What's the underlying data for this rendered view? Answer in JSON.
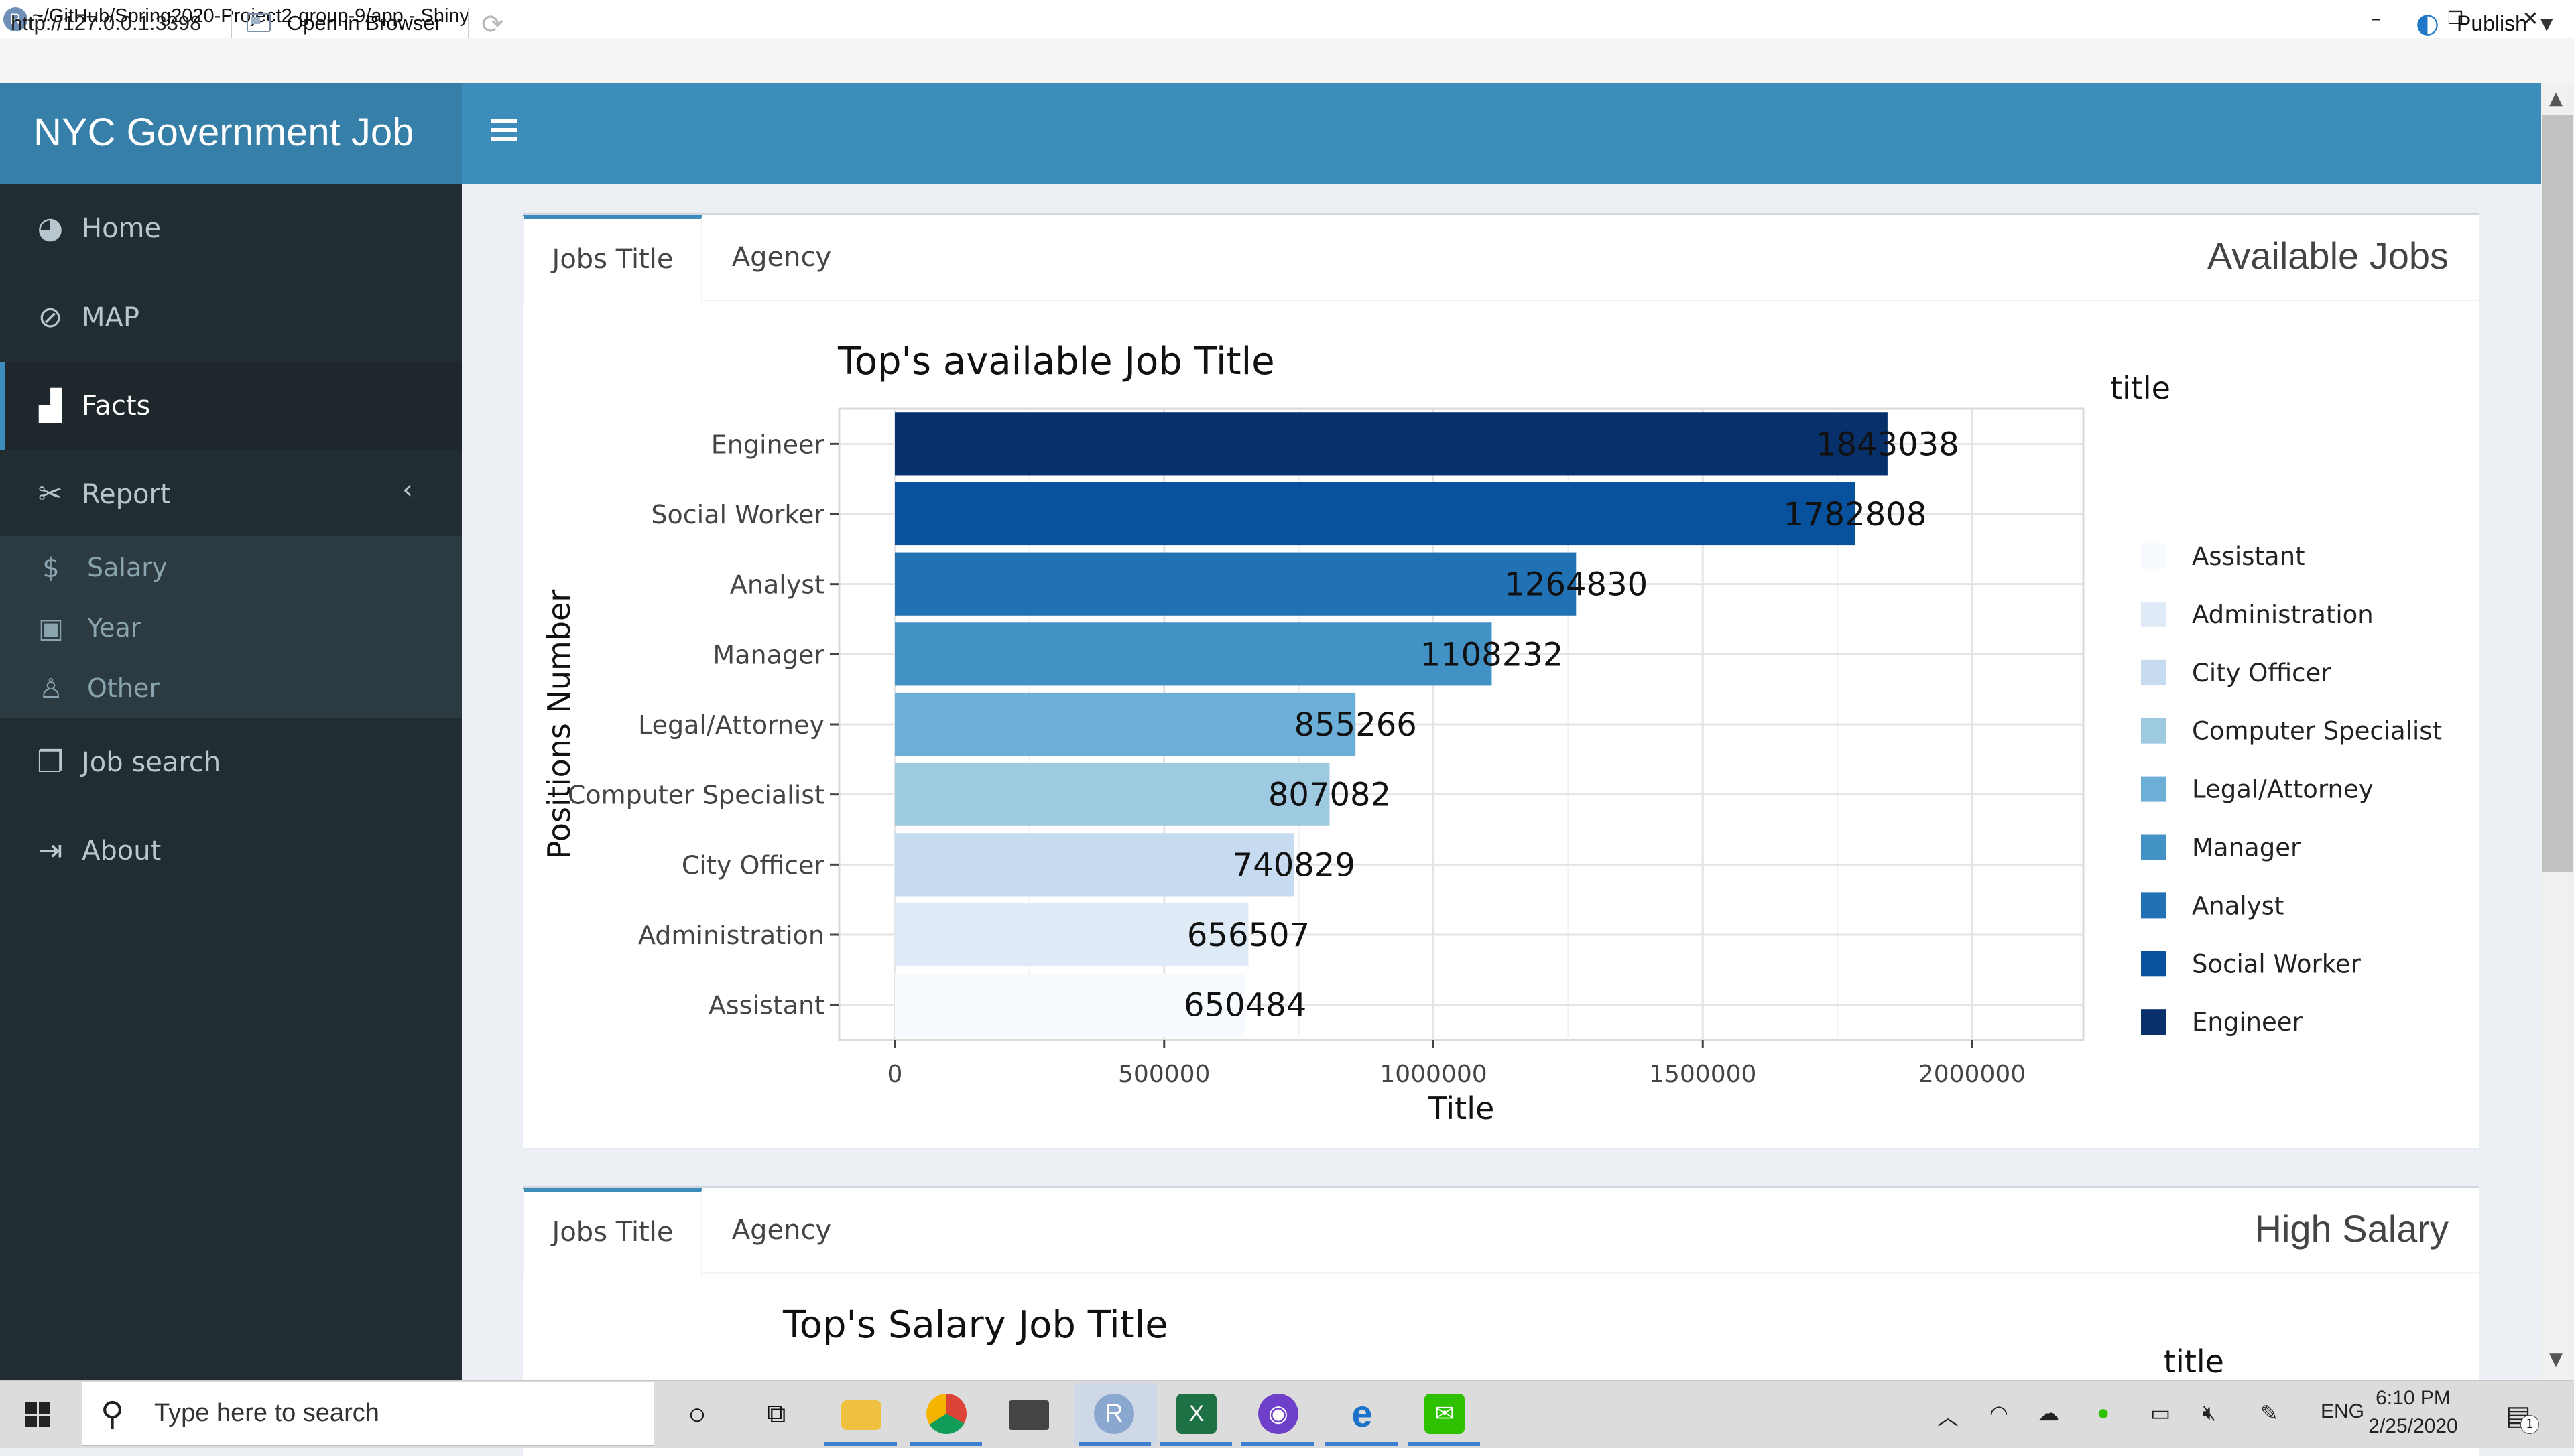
{
  "window": {
    "title": "~/GitHub/Spring2020-Project2-group-9/app - Shiny",
    "app_icon_letter": "R",
    "controls": [
      "–",
      "❐",
      "✕"
    ]
  },
  "addressbar": {
    "url": "http://127.0.0.1:3398",
    "open_in_browser": "Open in Browser",
    "publish": "Publish"
  },
  "header": {
    "brand": "NYC Government Job"
  },
  "sidebar": {
    "items": [
      {
        "label": "Home",
        "icon": "tachometer-icon"
      },
      {
        "label": "MAP",
        "icon": "compass-icon"
      },
      {
        "label": "Facts",
        "icon": "area-chart-icon"
      },
      {
        "label": "Report",
        "icon": "tools-icon"
      },
      {
        "label": "Job search",
        "icon": "clipboard-icon"
      },
      {
        "label": "About",
        "icon": "sign-out-icon"
      }
    ],
    "report_subitems": [
      {
        "label": "Salary",
        "icon": "dollar-icon"
      },
      {
        "label": "Year",
        "icon": "id-badge-icon"
      },
      {
        "label": "Other",
        "icon": "user-icon"
      }
    ],
    "active": "Facts"
  },
  "box1": {
    "tabs": [
      "Jobs Title",
      "Agency"
    ],
    "active_tab": "Jobs Title",
    "title": "Available Jobs"
  },
  "box2": {
    "tabs": [
      "Jobs Title",
      "Agency"
    ],
    "active_tab": "Jobs Title",
    "title": "High Salary",
    "chart_title": "Top's Salary Job Title",
    "legend_title": "title"
  },
  "chart_data": {
    "type": "bar",
    "orientation": "horizontal",
    "title": "Top's available Job Title",
    "xlabel": "Title",
    "ylabel": "Positions Number",
    "legend_title": "title",
    "legend_position": "right",
    "categories": [
      "Engineer",
      "Social Worker",
      "Analyst",
      "Manager",
      "Legal/Attorney",
      "Computer Specialist",
      "City Officer",
      "Administration",
      "Assistant"
    ],
    "values": [
      1843038,
      1782808,
      1264830,
      1108232,
      855266,
      807082,
      740829,
      656507,
      650484
    ],
    "value_labels": [
      "1843038",
      "1782808",
      "1264830",
      "1108232",
      "855266",
      "807082",
      "740829",
      "656507",
      "650484"
    ],
    "colors": [
      "#08306b",
      "#08519c",
      "#2171b5",
      "#4292c6",
      "#6baed6",
      "#9ecae1",
      "#c6dbef",
      "#deebf7",
      "#f7fbff"
    ],
    "legend_order": [
      "Assistant",
      "Administration",
      "City Officer",
      "Computer Specialist",
      "Legal/Attorney",
      "Manager",
      "Analyst",
      "Social Worker",
      "Engineer"
    ],
    "xticks": [
      "0",
      "500000",
      "1000000",
      "1500000",
      "2000000"
    ],
    "xlim": [
      0,
      2200000
    ],
    "grid": true
  },
  "taskbar": {
    "search_placeholder": "Type here to search",
    "language": "ENG",
    "time": "6:10 PM",
    "date": "2/25/2020",
    "notification_count": "1",
    "apps": [
      "cortana-icon",
      "task-view-icon",
      "file-explorer-icon",
      "chrome-icon",
      "mail-icon",
      "rstudio-icon",
      "excel-icon",
      "github-icon",
      "edge-icon",
      "wechat-icon"
    ]
  },
  "colors": {
    "header": "#3c8dbc",
    "brand": "#367fa9",
    "sidebar": "#222d32"
  }
}
